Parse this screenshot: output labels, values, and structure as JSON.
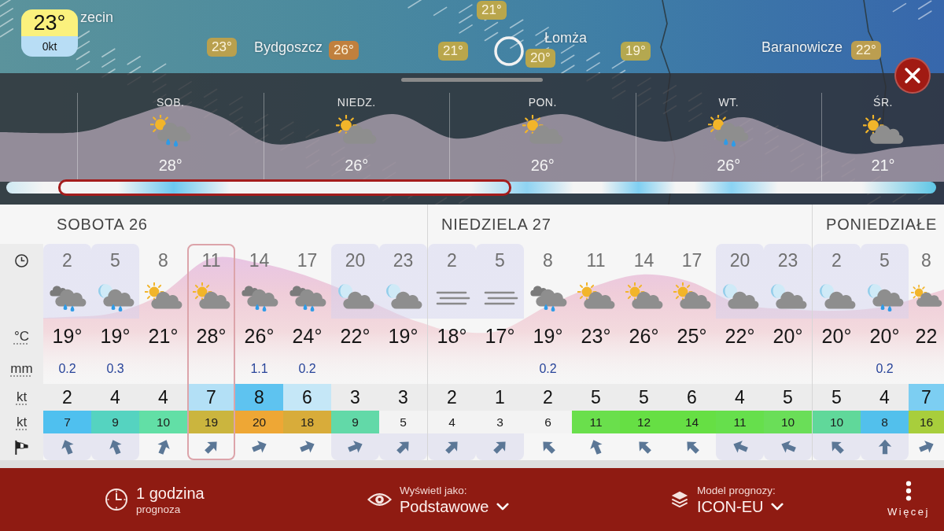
{
  "map": {
    "labels": [
      {
        "kind": "city",
        "text": "zecin"
      },
      {
        "kind": "temp",
        "text": "21°",
        "color": "#b9a64c"
      },
      {
        "kind": "temp",
        "text": "23°",
        "color": "#b9a04e"
      },
      {
        "kind": "city",
        "text": "Bydgoszcz"
      },
      {
        "kind": "temp",
        "text": "26°",
        "color": "#c0803e"
      },
      {
        "kind": "temp",
        "text": "21°",
        "color": "#b9a64c"
      },
      {
        "kind": "city",
        "text": "Łomża"
      },
      {
        "kind": "temp",
        "text": "20°",
        "color": "#b9a64c"
      },
      {
        "kind": "temp",
        "text": "19°",
        "color": "#b4a850"
      },
      {
        "kind": "city",
        "text": "Baranowicze"
      },
      {
        "kind": "temp",
        "text": "22°",
        "color": "#bb9e50"
      }
    ]
  },
  "current": {
    "temp": "23°",
    "wind": "0kt"
  },
  "daily": [
    {
      "day": "SOB.",
      "kind": "sun-rain",
      "temp": "28°"
    },
    {
      "day": "NIEDZ.",
      "kind": "sun-cloud",
      "temp": "26°"
    },
    {
      "day": "PON.",
      "kind": "sun-cloud",
      "temp": "26°"
    },
    {
      "day": "WT.",
      "kind": "sun-rain",
      "temp": "26°"
    },
    {
      "day": "ŚR.",
      "kind": "sun-cloud",
      "temp": "21°"
    }
  ],
  "row_units": {
    "temperature": "°C",
    "precipitation": "mm",
    "wind": "kt",
    "gust": "kt"
  },
  "days": [
    {
      "label": "SOBOTA 26",
      "hours": [
        {
          "hour": "2",
          "night": true,
          "selected": false,
          "kind": "rain",
          "temp": "19°",
          "rain": "0.2",
          "wind": {
            "value": "2"
          },
          "gust": {
            "value": "7",
            "color": "#4fc0ef"
          },
          "direction": {
            "kind": "nnw"
          }
        },
        {
          "hour": "5",
          "night": true,
          "selected": false,
          "kind": "moon-rain",
          "temp": "19°",
          "rain": "0.3",
          "wind": {
            "value": "4"
          },
          "gust": {
            "value": "9",
            "color": "#55d3c0"
          },
          "direction": {
            "kind": "nnw"
          }
        },
        {
          "hour": "8",
          "night": false,
          "selected": false,
          "kind": "sun-cloud",
          "temp": "21°",
          "wind": {
            "value": "4"
          },
          "gust": {
            "value": "10",
            "color": "#62dfa6"
          },
          "direction": {
            "kind": "nne"
          }
        },
        {
          "hour": "11",
          "night": false,
          "selected": true,
          "kind": "sun-cloud",
          "temp": "28°",
          "wind": {
            "value": "7",
            "color": "#b3e0f6"
          },
          "gust": {
            "value": "19",
            "color": "#cbb53e"
          },
          "direction": {
            "kind": "ne"
          }
        },
        {
          "hour": "14",
          "night": false,
          "selected": false,
          "kind": "rain",
          "temp": "26°",
          "rain": "1.1",
          "wind": {
            "value": "8",
            "color": "#5ec3f0"
          },
          "gust": {
            "value": "20",
            "color": "#eea735"
          },
          "direction": {
            "kind": "ene"
          }
        },
        {
          "hour": "17",
          "night": false,
          "selected": false,
          "kind": "rain",
          "temp": "24°",
          "rain": "0.2",
          "wind": {
            "value": "6",
            "color": "#c5e7f7"
          },
          "gust": {
            "value": "18",
            "color": "#d8ac3a"
          },
          "direction": {
            "kind": "ene"
          }
        },
        {
          "hour": "20",
          "night": true,
          "selected": false,
          "kind": "moon-cloud",
          "temp": "22°",
          "wind": {
            "value": "3"
          },
          "gust": {
            "value": "9",
            "color": "#62d9a8"
          },
          "direction": {
            "kind": "ene"
          }
        },
        {
          "hour": "23",
          "night": true,
          "selected": false,
          "kind": "moon-cloud",
          "temp": "19°",
          "wind": {
            "value": "3"
          },
          "gust": {
            "value": "5"
          },
          "direction": {
            "kind": "ne"
          }
        }
      ]
    },
    {
      "label": "NIEDZIELA 27",
      "hours": [
        {
          "hour": "2",
          "night": true,
          "selected": false,
          "kind": "fog",
          "temp": "18°",
          "wind": {
            "value": "2"
          },
          "gust": {
            "value": "4"
          },
          "direction": {
            "kind": "ne"
          }
        },
        {
          "hour": "5",
          "night": true,
          "selected": false,
          "kind": "fog",
          "temp": "17°",
          "wind": {
            "value": "1"
          },
          "gust": {
            "value": "3"
          },
          "direction": {
            "kind": "ne"
          }
        },
        {
          "hour": "8",
          "night": false,
          "selected": false,
          "kind": "rain",
          "temp": "19°",
          "rain": "0.2",
          "wind": {
            "value": "2"
          },
          "gust": {
            "value": "6"
          },
          "direction": {
            "kind": "nw"
          }
        },
        {
          "hour": "11",
          "night": false,
          "selected": false,
          "kind": "sun-cloud",
          "temp": "23°",
          "wind": {
            "value": "5"
          },
          "gust": {
            "value": "11",
            "color": "#6adf4c"
          },
          "direction": {
            "kind": "nnw"
          }
        },
        {
          "hour": "14",
          "night": false,
          "selected": false,
          "kind": "sun-cloud",
          "temp": "26°",
          "wind": {
            "value": "5"
          },
          "gust": {
            "value": "12",
            "color": "#66df44"
          },
          "direction": {
            "kind": "nw"
          }
        },
        {
          "hour": "17",
          "night": false,
          "selected": false,
          "kind": "sun-cloud",
          "temp": "25°",
          "wind": {
            "value": "6"
          },
          "gust": {
            "value": "14",
            "color": "#66df44"
          },
          "direction": {
            "kind": "nw"
          }
        },
        {
          "hour": "20",
          "night": true,
          "selected": false,
          "kind": "moon-cloud",
          "temp": "22°",
          "wind": {
            "value": "4"
          },
          "gust": {
            "value": "11",
            "color": "#66df4c"
          },
          "direction": {
            "kind": "wnw"
          }
        },
        {
          "hour": "23",
          "night": true,
          "selected": false,
          "kind": "moon-cloud",
          "temp": "20°",
          "wind": {
            "value": "5"
          },
          "gust": {
            "value": "10",
            "color": "#6ade58"
          },
          "direction": {
            "kind": "wnw"
          }
        }
      ]
    },
    {
      "label": "PONIEDZIAŁE",
      "hours": [
        {
          "hour": "2",
          "night": true,
          "selected": false,
          "kind": "moon-cloud",
          "temp": "20°",
          "wind": {
            "value": "5"
          },
          "gust": {
            "value": "10",
            "color": "#60d89a"
          },
          "direction": {
            "kind": "nw"
          }
        },
        {
          "hour": "5",
          "night": true,
          "selected": false,
          "kind": "moon-rain",
          "temp": "20°",
          "rain": "0.2",
          "wind": {
            "value": "4"
          },
          "gust": {
            "value": "8",
            "color": "#52c0ec"
          },
          "direction": {
            "kind": "n"
          }
        },
        {
          "hour": "8",
          "night": false,
          "selected": false,
          "kind": "sun-cloud",
          "temp": "22",
          "wind": {
            "value": "7",
            "color": "#7ccef2"
          },
          "gust": {
            "value": "16",
            "color": "#a8ce3c"
          },
          "direction": {
            "kind": "ene"
          }
        }
      ]
    }
  ],
  "bottom_bar": [
    {
      "kind": "interval",
      "title": "1 godzina",
      "caption": "prognoza"
    },
    {
      "kind": "display",
      "caption": "Wyświetl jako:",
      "value": "Podstawowe"
    },
    {
      "kind": "model",
      "caption": "Model prognozy:",
      "value": "ICON-EU"
    },
    {
      "kind": "more",
      "label": "Więcej"
    }
  ]
}
